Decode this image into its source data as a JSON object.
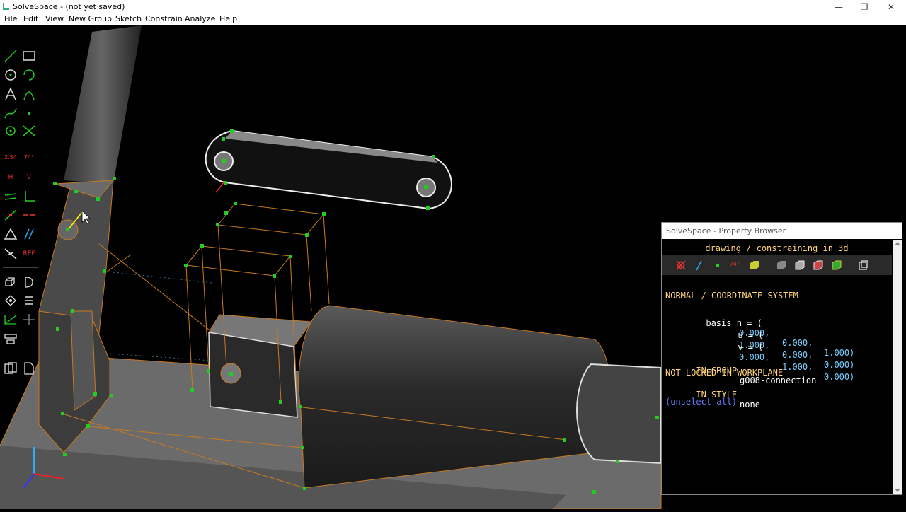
{
  "window": {
    "title": "SolveSpace - (not yet saved)",
    "controls": {
      "minimize": "—",
      "restore": "❐",
      "close": "✕"
    }
  },
  "menu": [
    "File",
    "Edit",
    "View",
    "New Group",
    "Sketch",
    "Constrain",
    "Analyze",
    "Help"
  ],
  "toolbar": {
    "dimension_label": "2.54",
    "angle_label": "74°",
    "horizontal_label": "H",
    "vertical_label": "V",
    "reference_label": "REF"
  },
  "property_browser": {
    "title": "SolveSpace - Property Browser",
    "header": "drawing / constraining in 3d",
    "icons": [
      "workplane-icon",
      "normal-icon",
      "point-icon",
      "angle-icon",
      "face-icon",
      "solid-icon",
      "shaded-icon",
      "mesh-icon",
      "outline-icon",
      "hidden-icon"
    ],
    "angle_icon_label": "74°",
    "section_title": "NORMAL / COORDINATE SYSTEM",
    "basis": {
      "n_label": "basis n = (",
      "u_label": "u = (",
      "v_label": "v = (",
      "n": [
        "0.000,",
        "0.000,",
        "1.000)"
      ],
      "u": [
        "1.000,",
        "0.000,",
        "0.000)"
      ],
      "v": [
        "0.000,",
        "1.000,",
        "0.000)"
      ]
    },
    "in_group_label": "IN GROUP",
    "in_group_value": "g008-connection",
    "not_locked": "NOT LOCKED IN WORKPLANE",
    "in_style_label": "IN STYLE",
    "in_style_value": "none",
    "unselect": "(unselect all)"
  },
  "colors": {
    "accent_green": "#22cc22",
    "edge_orange": "#c87a20",
    "text_orange": "#ffd37a",
    "value_cyan": "#7ad0ff",
    "link_blue": "#6a7aff"
  }
}
